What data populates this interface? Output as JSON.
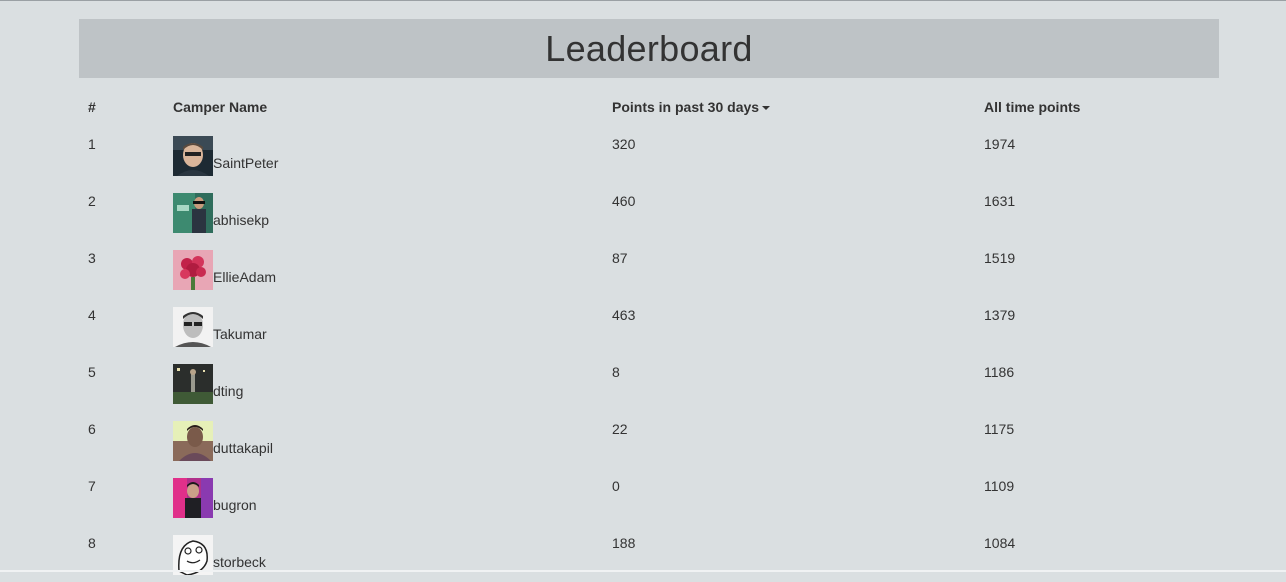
{
  "header": {
    "title": "Leaderboard"
  },
  "table": {
    "columns": {
      "rank": "#",
      "name": "Camper Name",
      "recent": "Points in past 30 days",
      "alltime": "All time points"
    },
    "rows": [
      {
        "rank": "1",
        "name": "SaintPeter",
        "recent": "320",
        "alltime": "1974"
      },
      {
        "rank": "2",
        "name": "abhisekp",
        "recent": "460",
        "alltime": "1631"
      },
      {
        "rank": "3",
        "name": "EllieAdam",
        "recent": "87",
        "alltime": "1519"
      },
      {
        "rank": "4",
        "name": "Takumar",
        "recent": "463",
        "alltime": "1379"
      },
      {
        "rank": "5",
        "name": "dting",
        "recent": "8",
        "alltime": "1186"
      },
      {
        "rank": "6",
        "name": "duttakapil",
        "recent": "22",
        "alltime": "1175"
      },
      {
        "rank": "7",
        "name": "bugron",
        "recent": "0",
        "alltime": "1109"
      },
      {
        "rank": "8",
        "name": "storbeck",
        "recent": "188",
        "alltime": "1084"
      }
    ]
  },
  "colors": {
    "background": "#dadfe1",
    "header_bar": "#bec3c6",
    "text": "#333333"
  }
}
